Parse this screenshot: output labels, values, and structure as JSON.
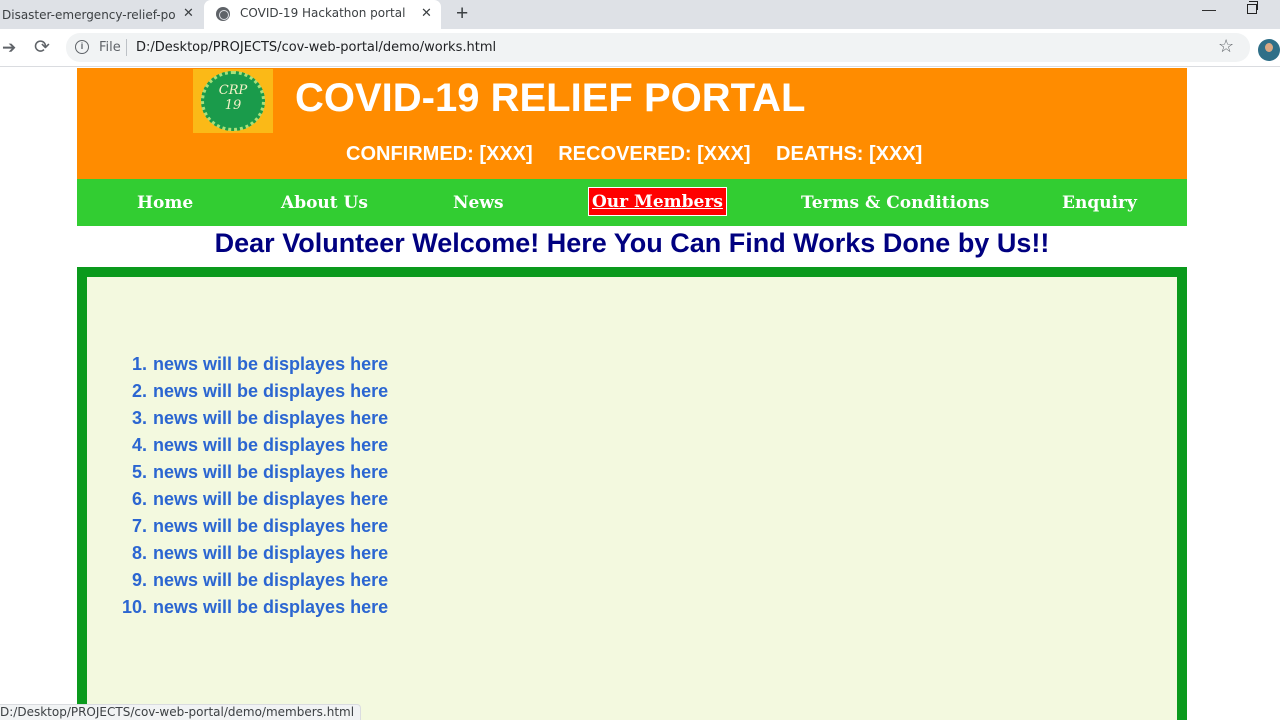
{
  "browser": {
    "tabs": [
      {
        "title": "Disaster-emergency-relief-portal",
        "close": "✕"
      },
      {
        "title": "COVID-19 Hackathon portal",
        "close": "✕"
      }
    ],
    "new_tab": "+",
    "omnibox": {
      "scheme_label": "File",
      "url": "D:/Desktop/PROJECTS/cov-web-portal/demo/works.html"
    },
    "status_url": "D:/Desktop/PROJECTS/cov-web-portal/demo/members.html",
    "icons": [
      "forward-icon",
      "reload-icon",
      "info-icon",
      "bookmark-star-icon",
      "profile-avatar",
      "globe-icon",
      "minimize-icon",
      "restore-icon"
    ]
  },
  "header": {
    "logo_text_line1": "CRP",
    "logo_text_line2": "19",
    "title": "COVID-19 RELIEF PORTAL",
    "stats": {
      "confirmed": "CONFIRMED: [XXX]",
      "recovered": "RECOVERED: [XXX]",
      "deaths": "DEATHS: [XXX]"
    },
    "colors": {
      "header_bg": "#ff8c00",
      "nav_bg": "#32cd32",
      "active_nav_bg": "#ff0000"
    }
  },
  "nav": {
    "items": [
      "Home",
      "About Us",
      "News",
      "Our Members",
      "Terms & Conditions",
      "Enquiry"
    ],
    "active": "Our Members"
  },
  "main": {
    "welcome": "Dear Volunteer Welcome! Here You Can Find Works Done by Us!!",
    "news": [
      {
        "num": "1.",
        "text": "news will be displayes here"
      },
      {
        "num": "2.",
        "text": "news will be displayes here"
      },
      {
        "num": "3.",
        "text": "news will be displayes here"
      },
      {
        "num": "4.",
        "text": "news will be displayes here"
      },
      {
        "num": "5.",
        "text": "news will be displayes here"
      },
      {
        "num": "6.",
        "text": "news will be displayes here"
      },
      {
        "num": "7.",
        "text": "news will be displayes here"
      },
      {
        "num": "8.",
        "text": "news will be displayes here"
      },
      {
        "num": "9.",
        "text": "news will be displayes here"
      },
      {
        "num": "10.",
        "text": "news will be displayes here"
      }
    ],
    "colors": {
      "box_border": "#0a9a1c",
      "box_bg": "#f3f9df",
      "news_text": "#2b66d1",
      "welcome_text": "#000080"
    }
  }
}
